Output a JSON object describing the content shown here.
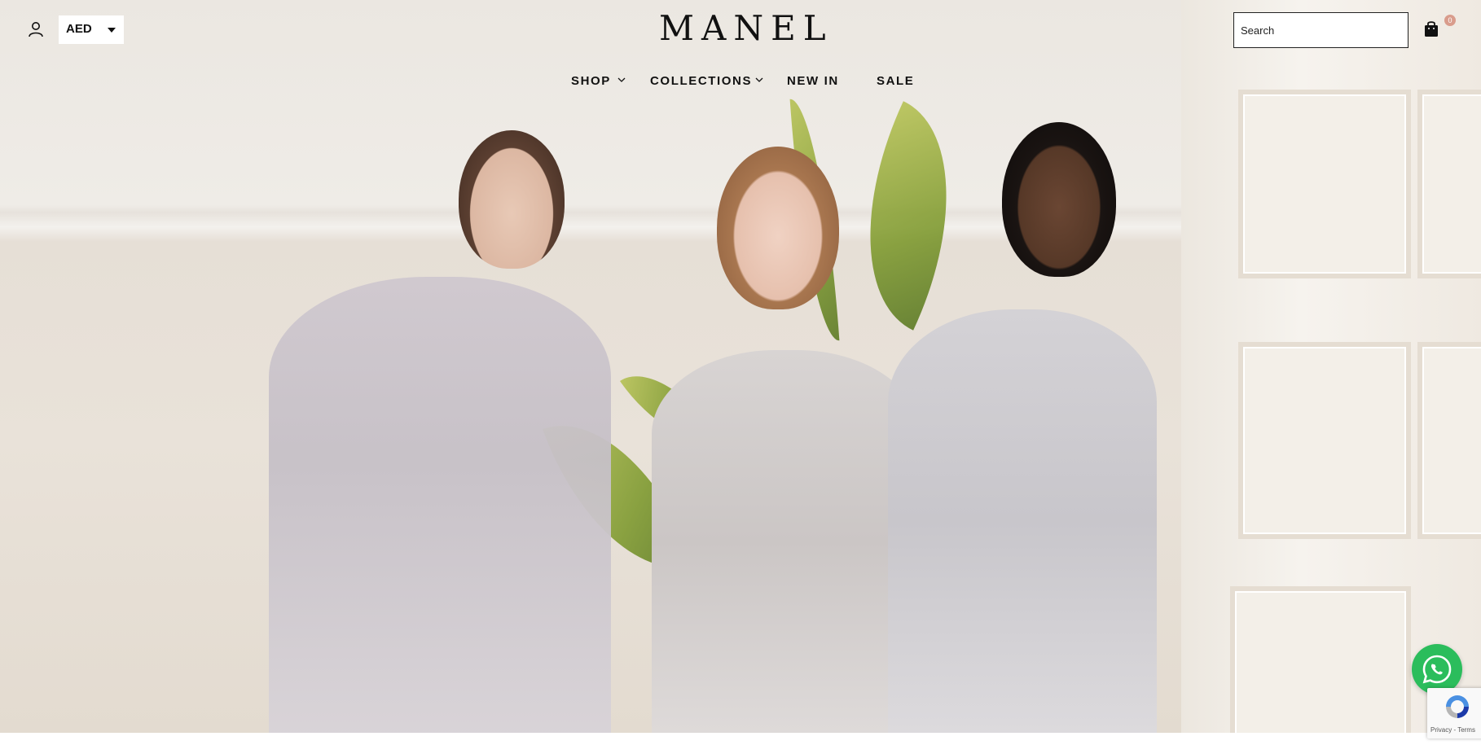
{
  "header": {
    "account_icon": "user-outline-icon",
    "currency": {
      "selected": "AED"
    },
    "logo_text": "MANEL",
    "search": {
      "placeholder": "Search"
    },
    "cart": {
      "icon": "shopping-bag-icon",
      "count": "0"
    }
  },
  "nav": {
    "items": [
      {
        "label": "SHOP",
        "has_dropdown": true
      },
      {
        "label": "COLLECTIONS",
        "has_dropdown": true
      },
      {
        "label": "NEW IN",
        "has_dropdown": false
      },
      {
        "label": "SALE",
        "has_dropdown": false
      }
    ]
  },
  "hero": {
    "image": "three-models-in-silver-gowns"
  },
  "widgets": {
    "whatsapp_icon": "whatsapp-icon",
    "recaptcha_text": "Privacy - Terms"
  },
  "colors": {
    "text": "#111111",
    "badge": "#d99c8c",
    "whatsapp": "#2bbd5c"
  }
}
